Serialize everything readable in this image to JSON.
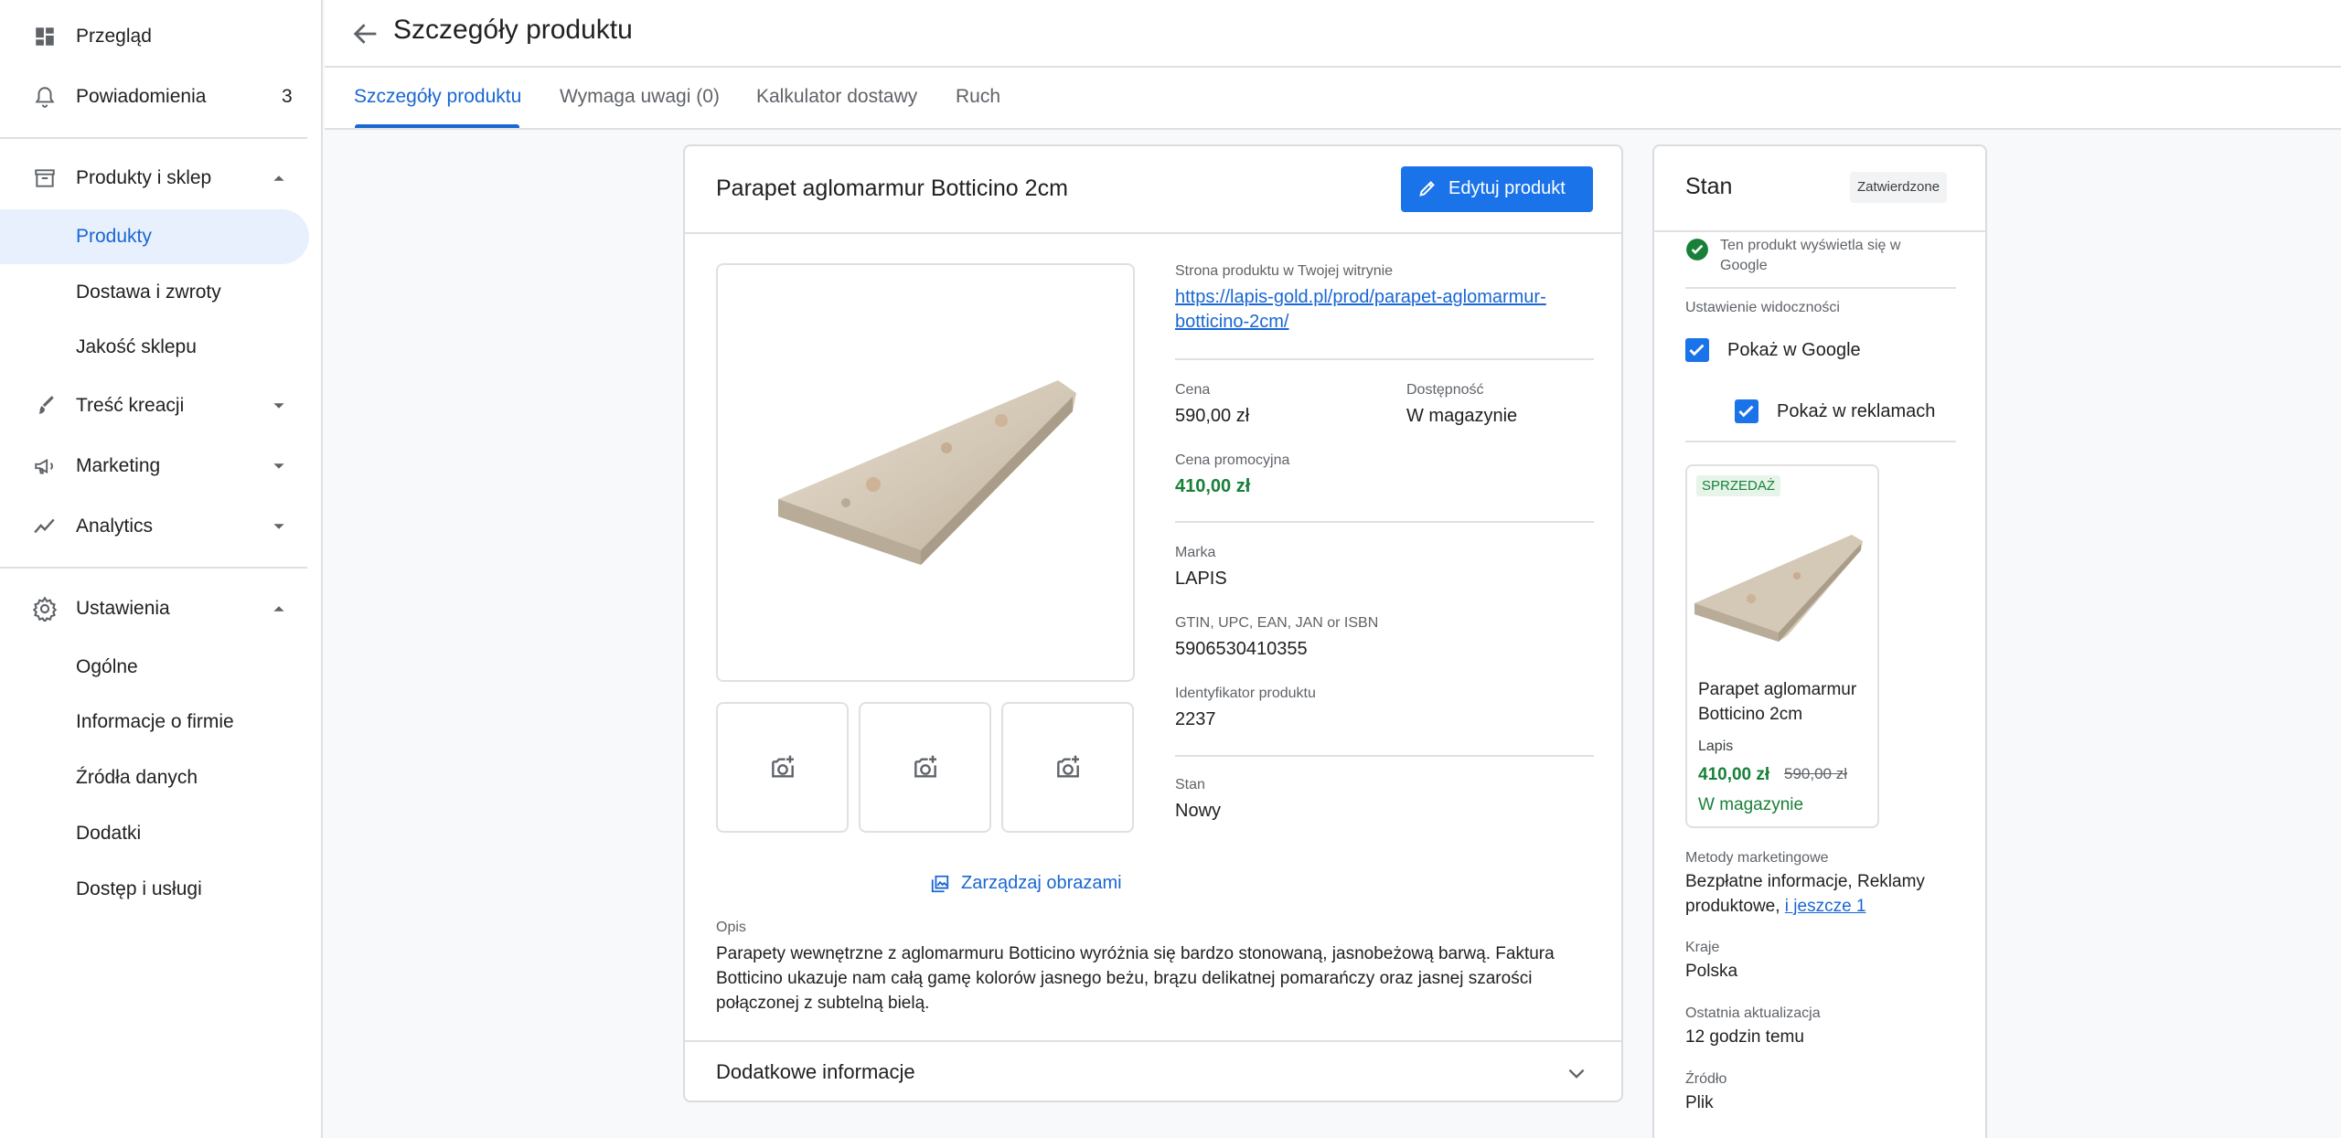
{
  "sidebar": {
    "items": [
      {
        "label": "Przegląd",
        "icon": "dashboard-icon"
      },
      {
        "label": "Powiadomienia",
        "icon": "bell-icon",
        "badge": "3"
      },
      {
        "label": "Produkty i sklep",
        "icon": "store-icon"
      },
      {
        "label": "Produkty"
      },
      {
        "label": "Dostawa i zwroty"
      },
      {
        "label": "Jakość sklepu"
      },
      {
        "label": "Treść kreacji",
        "icon": "brush-icon"
      },
      {
        "label": "Marketing",
        "icon": "megaphone-icon"
      },
      {
        "label": "Analytics",
        "icon": "trend-icon"
      },
      {
        "label": "Ustawienia",
        "icon": "gear-icon"
      },
      {
        "label": "Ogólne"
      },
      {
        "label": "Informacje o firmie"
      },
      {
        "label": "Źródła danych"
      },
      {
        "label": "Dodatki"
      },
      {
        "label": "Dostęp i usługi"
      }
    ]
  },
  "header": {
    "title": "Szczegóły produktu"
  },
  "tabs": [
    {
      "label": "Szczegóły produktu"
    },
    {
      "label": "Wymaga uwagi (0)"
    },
    {
      "label": "Kalkulator dostawy"
    },
    {
      "label": "Ruch"
    }
  ],
  "product": {
    "title": "Parapet aglomarmur Botticino 2cm",
    "edit_label": "Edytuj produkt",
    "manage_images_label": "Zarządzaj obrazami",
    "page_label": "Strona produktu w Twojej witrynie",
    "page_url_line1": "https://lapis-gold.pl/prod/parapet-aglomarmur-",
    "page_url_line2": "botticino-2cm/",
    "price_label": "Cena",
    "price": "590,00 zł",
    "availability_label": "Dostępność",
    "availability": "W magazynie",
    "sale_price_label": "Cena promocyjna",
    "sale_price": "410,00 zł",
    "brand_label": "Marka",
    "brand": "LAPIS",
    "gtin_label": "GTIN, UPC, EAN, JAN or ISBN",
    "gtin": "5906530410355",
    "id_label": "Identyfikator produktu",
    "id": "2237",
    "condition_label": "Stan",
    "condition": "Nowy",
    "desc_label": "Opis",
    "description": "Parapety wewnętrzne z aglomarmuru Botticino wyróżnia się bardzo stonowaną, jasnobeżową barwą. Faktura Botticino ukazuje nam całą gamę kolorów jasnego beżu, brązu delikatnej pomarańczy oraz jasnej szarości połączonej z subtelną bielą.",
    "more_info_label": "Dodatkowe informacje"
  },
  "status": {
    "title": "Stan",
    "chip": "Zatwierdzone",
    "shown_line1": "Ten produkt wyświetla się w",
    "shown_line2": "Google",
    "visibility_label": "Ustawienie widoczności",
    "show_google": "Pokaż w Google",
    "show_ads": "Pokaż w reklamach",
    "preview": {
      "sale_tag": "SPRZEDAŻ",
      "name_line1": "Parapet aglomarmur",
      "name_line2": "Botticino 2cm",
      "brand": "Lapis",
      "sale_price": "410,00 zł",
      "old_price": "590,00 zł",
      "stock": "W magazynie"
    },
    "methods_label": "Metody marketingowe",
    "methods_line1": "Bezpłatne informacje, Reklamy",
    "methods_line2": "produktowe, ",
    "methods_more": "i jeszcze 1",
    "countries_label": "Kraje",
    "countries": "Polska",
    "updated_label": "Ostatnia aktualizacja",
    "updated": "12 godzin temu",
    "source_label": "Źródło",
    "source": "Plik"
  },
  "colors": {
    "accent": "#1a73e8",
    "green": "#188038"
  }
}
